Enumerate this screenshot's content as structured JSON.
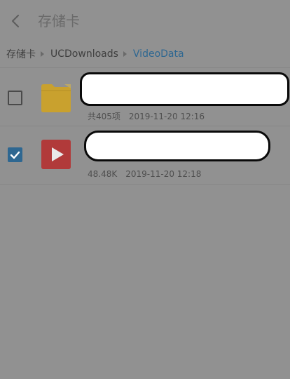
{
  "header": {
    "title": "存储卡",
    "back_icon": "chevron-left-icon"
  },
  "breadcrumb": {
    "items": [
      {
        "label": "存储卡",
        "current": false
      },
      {
        "label": "UCDownloads",
        "current": false
      },
      {
        "label": "VideoData",
        "current": true
      }
    ],
    "separator_icon": "triangle-right-icon"
  },
  "files": [
    {
      "type": "folder",
      "icon": "folder-icon",
      "checked": false,
      "name": "",
      "name_redacted": true,
      "size": "共405项",
      "date": "2019-11-20 12:16"
    },
    {
      "type": "video",
      "icon": "video-play-icon",
      "checked": true,
      "name": "",
      "name_redacted": true,
      "size": "48.48K",
      "date": "2019-11-20 12:18"
    }
  ],
  "colors": {
    "overlay_background": "#919191",
    "accent": "#2e6791",
    "folder": "#c9a12e",
    "video": "#b13a3a"
  }
}
